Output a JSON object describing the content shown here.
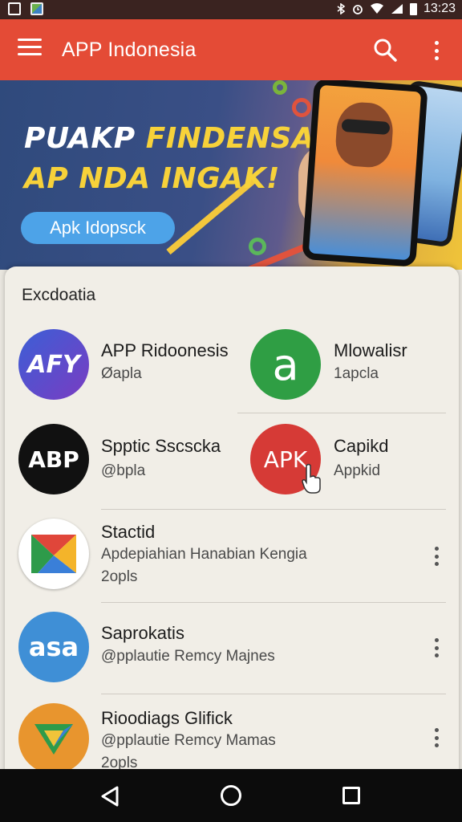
{
  "status_bar": {
    "time": "13:23"
  },
  "app_bar": {
    "title": "APP Indonesia"
  },
  "banner": {
    "line1_part1": "PUAKP",
    "line1_part2": "FINDENSA",
    "line2": "AP NDA INGAK!",
    "button_label": "Apk Idopsck"
  },
  "section": {
    "title": "Excdoatia",
    "grid_apps": [
      {
        "name": "APP Ridoonesis",
        "sub": "Øapla",
        "icon_text": "AFY",
        "icon": "afy-app-icon",
        "color": "#6a3fc7"
      },
      {
        "name": "Mlowalisr",
        "sub": "1apcla",
        "icon_text": "a",
        "icon": "green-a-app-icon",
        "color": "#2f9e44"
      },
      {
        "name": "Spptic Sscscka",
        "sub": "@bpla",
        "icon_text": "ABP",
        "icon": "abp-app-icon",
        "color": "#111111"
      },
      {
        "name": "Capikd",
        "sub": "Appkid",
        "icon_text": "APK",
        "icon": "apk-app-icon",
        "color": "#d63a36"
      }
    ],
    "list_apps": [
      {
        "name": "Stactid",
        "sub1": "Apdepiahian Hanabian Kengia",
        "sub2": "2opls",
        "icon": "google-maps-style-app-icon"
      },
      {
        "name": "Saprokatis",
        "sub1": "@pplautie Remcy Majnes",
        "sub2": "",
        "icon_text": "asa",
        "icon": "asa-app-icon",
        "color": "#3f8fd6"
      },
      {
        "name": "Rioodiags Glifick",
        "sub1": "@pplautie Remcy Mamas",
        "sub2": "2opls",
        "icon": "triangle-app-icon"
      }
    ]
  },
  "nav_bar": {
    "back_icon": "back-triangle-icon",
    "home_icon": "home-circle-icon",
    "recent_icon": "recents-square-icon"
  },
  "colors": {
    "app_bar": "#e44b36",
    "banner_button": "#4da3e8",
    "accent_yellow": "#f7d23a"
  }
}
